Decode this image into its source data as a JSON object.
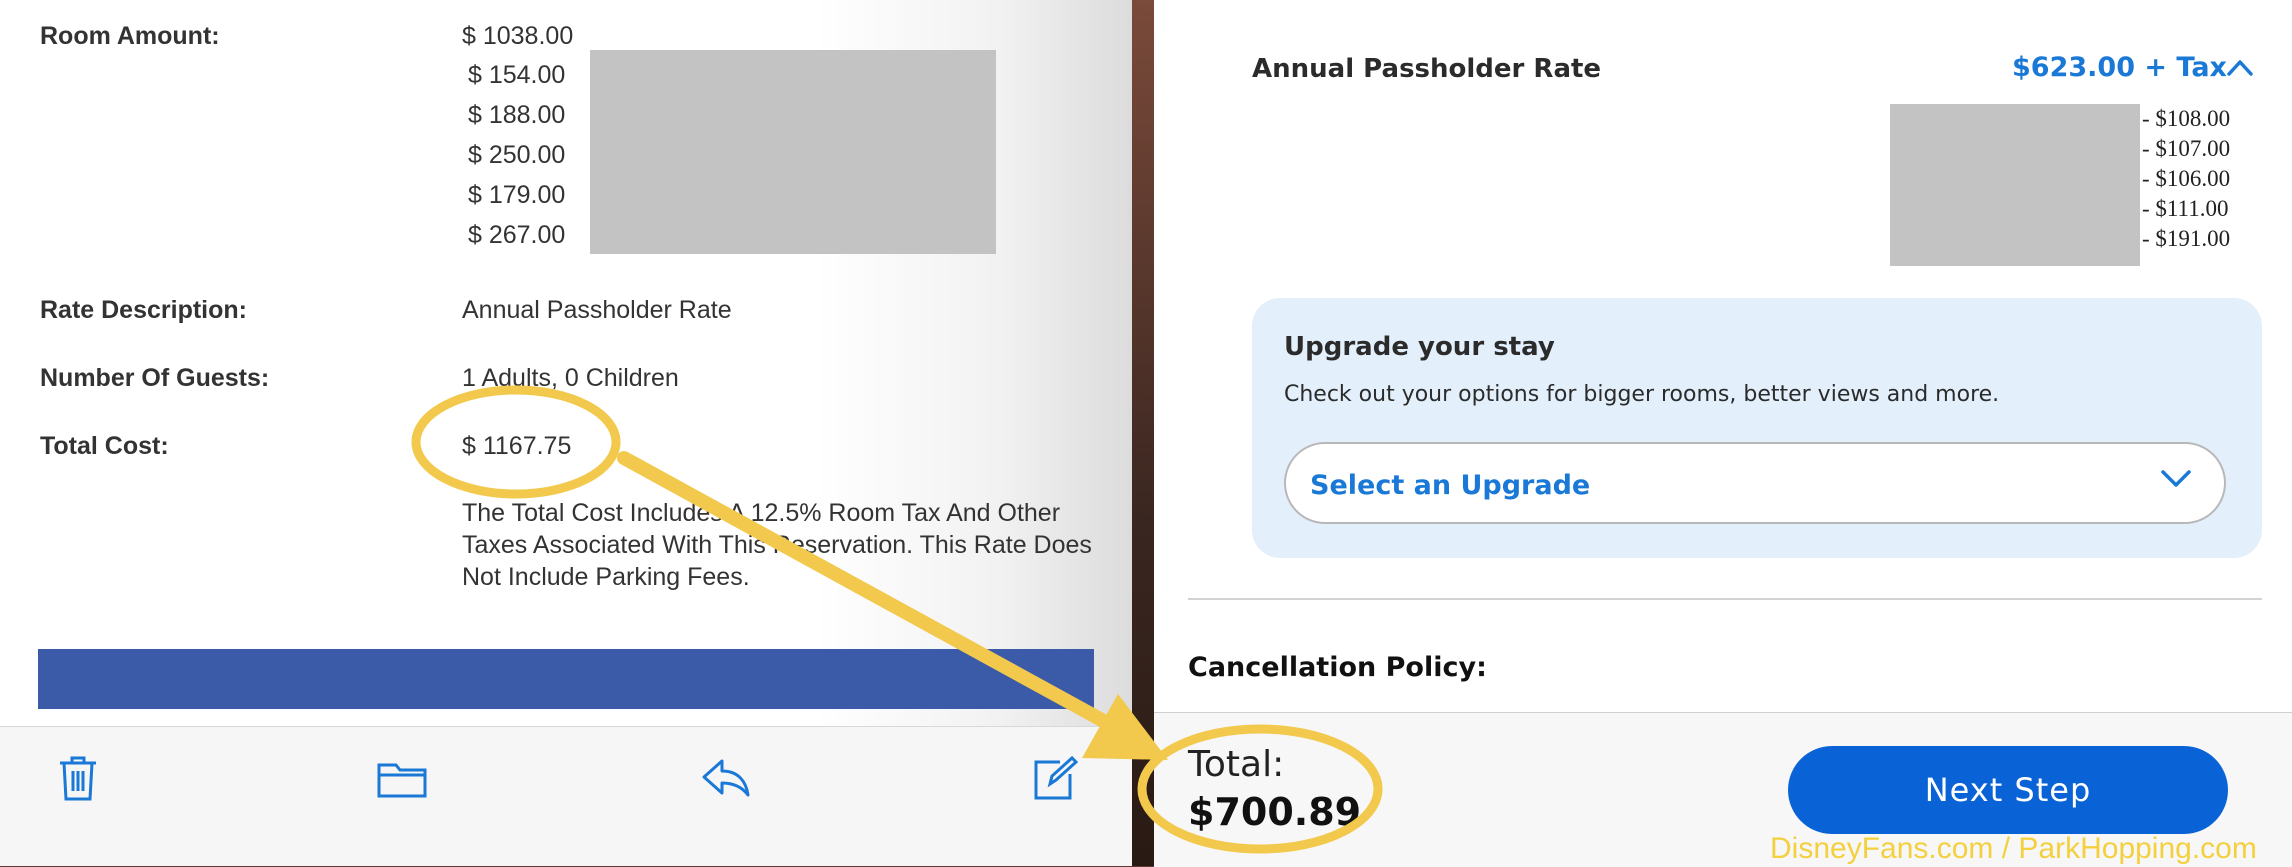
{
  "email": {
    "room_amount_label": "Room Amount:",
    "room_amounts": [
      "$ 1038.00",
      "$ 154.00",
      "$ 188.00",
      "$ 250.00",
      "$ 179.00",
      "$ 267.00"
    ],
    "rate_description_label": "Rate Description:",
    "rate_description_value": "Annual Passholder Rate",
    "guests_label": "Number Of Guests:",
    "guests_value": "1 Adults, 0 Children",
    "total_cost_label": "Total Cost:",
    "total_cost_value": "$ 1167.75",
    "note": "The Total Cost Includes A 12.5% Room Tax And Other Taxes Associated With This Reservation. This Rate Does Not Include Parking Fees.",
    "toolbar": {
      "icons": [
        "trash-icon",
        "folder-icon",
        "reply-icon",
        "compose-icon"
      ]
    }
  },
  "booking": {
    "rate_label": "Annual Passholder Rate",
    "rate_price": "$623.00 + Tax",
    "nightly_discounts": [
      "- $108.00",
      "- $107.00",
      "- $106.00",
      "- $111.00",
      "- $191.00"
    ],
    "upgrade_title": "Upgrade your stay",
    "upgrade_desc": "Check out your options for bigger rooms, better views and more.",
    "upgrade_select_label": "Select an Upgrade",
    "cancellation_title": "Cancellation Policy:",
    "total_label": "Total:",
    "total_value": "$700.89",
    "next_button": "Next Step",
    "accent_color": "#1a78d6",
    "button_color": "#0a63d6"
  },
  "annotation": {
    "highlight_color": "#f2c94c",
    "watermark": "DisneyFans.com / ParkHopping.com"
  }
}
